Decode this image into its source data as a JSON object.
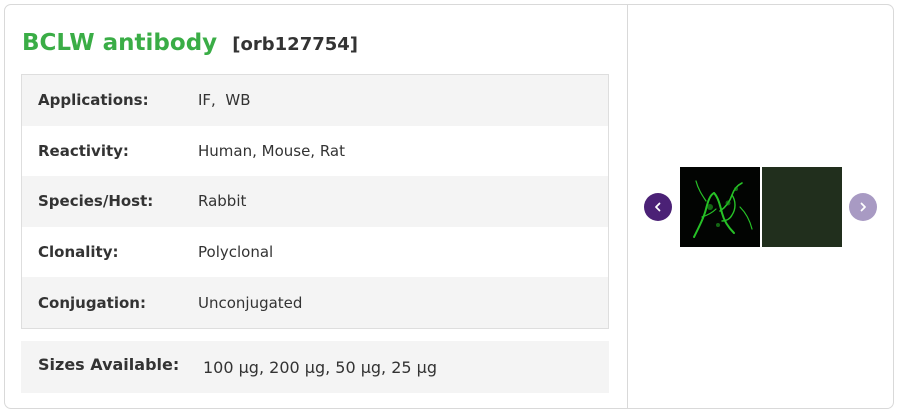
{
  "product": {
    "name": "BCLW antibody",
    "code": "[orb127754]"
  },
  "specs": [
    {
      "label": "Applications:",
      "value": "IF,  WB"
    },
    {
      "label": "Reactivity:",
      "value": "Human, Mouse, Rat"
    },
    {
      "label": "Species/Host:",
      "value": "Rabbit"
    },
    {
      "label": "Clonality:",
      "value": "Polyclonal"
    },
    {
      "label": "Conjugation:",
      "value": "Unconjugated"
    }
  ],
  "sizes": {
    "label": "Sizes Available:",
    "value": "100 µg, 200 µg, 50 µg, 25 µg"
  },
  "gallery": {
    "prev_icon": "chevron-left-icon",
    "next_icon": "chevron-right-icon",
    "thumbnails": [
      {
        "name": "if-staining-thumbnail"
      },
      {
        "name": "control-thumbnail"
      }
    ],
    "colors": {
      "prev_button": "#4b2176",
      "next_button": "#a89ac3",
      "title_green": "#3aad46"
    }
  }
}
